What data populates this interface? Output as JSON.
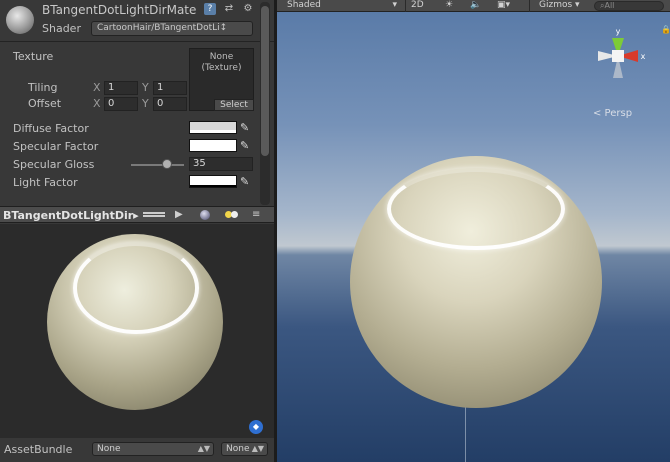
{
  "inspector": {
    "material_name": "BTangentDotLightDirMate",
    "shader_label": "Shader",
    "shader_value": "CartoonHair/BTangentDotLi↕",
    "texture_label": "Texture",
    "texture_none": "None",
    "texture_type": "(Texture)",
    "texture_select": "Select",
    "tiling_label": "Tiling",
    "offset_label": "Offset",
    "x_label": "X",
    "y_label": "Y",
    "tiling_x": "1",
    "tiling_y": "1",
    "offset_x": "0",
    "offset_y": "0",
    "diffuse_label": "Diffuse Factor",
    "specular_label": "Specular Factor",
    "gloss_label": "Specular Gloss",
    "gloss_value": "35",
    "light_label": "Light Factor"
  },
  "preview": {
    "title": "BTangentDotLightDir▸",
    "play_icon": "▶",
    "settings_icon": "≡"
  },
  "assetbundle": {
    "label": "AssetBundle",
    "bundle": "None",
    "variant": "None"
  },
  "scene_toolbar": {
    "shading_mode": "Shaded",
    "mode_2d": "2D",
    "gizmos": "Gizmos",
    "search_placeholder": "⌕All"
  },
  "scene": {
    "persp_label": "< Persp",
    "axis_y": "y",
    "axis_x": "x"
  },
  "colors": {
    "sphere_tint": "#d6d2ba",
    "gizmo_y": "#7dcb37",
    "gizmo_x": "#d83a2b",
    "accent_blue": "#2f6fd1"
  }
}
